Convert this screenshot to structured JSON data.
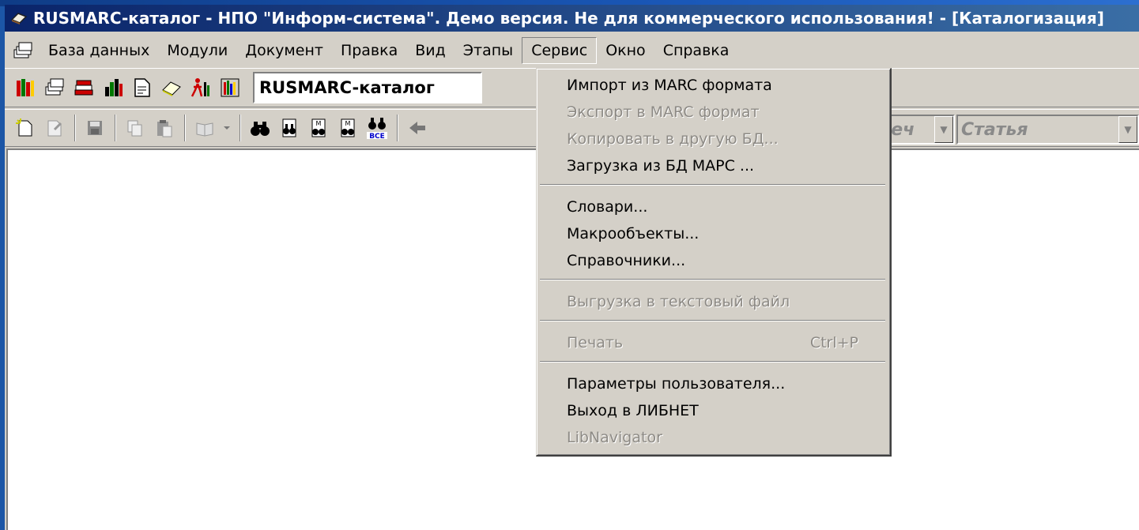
{
  "window": {
    "title": "RUSMARC-каталог - НПО \"Информ-система\". Демо версия. Не для коммерческого использования! - [Каталогизация]"
  },
  "menubar": {
    "items": [
      {
        "label": "База данных"
      },
      {
        "label": "Модули"
      },
      {
        "label": "Документ"
      },
      {
        "label": "Правка"
      },
      {
        "label": "Вид"
      },
      {
        "label": "Этапы"
      },
      {
        "label": "Сервис"
      },
      {
        "label": "Окно"
      },
      {
        "label": "Справка"
      }
    ],
    "active": "Сервис"
  },
  "toolbar1": {
    "database_value": "RUSMARC-каталог"
  },
  "toolbar2": {
    "combo1_value": "неч",
    "combo2_value": "Статья"
  },
  "service_menu": {
    "items": [
      {
        "label": "Импорт из MARC формата",
        "enabled": true
      },
      {
        "label": "Экспорт в MARC формат",
        "enabled": false
      },
      {
        "label": "Копировать в другую БД...",
        "enabled": false
      },
      {
        "label": "Загрузка из БД МАРС ...",
        "enabled": true
      },
      {
        "label": "Словари...",
        "enabled": true
      },
      {
        "label": "Макрообъекты...",
        "enabled": true
      },
      {
        "label": "Справочники...",
        "enabled": true
      },
      {
        "label": "Выгрузка в текстовый файл",
        "enabled": false
      },
      {
        "label": "Печать",
        "shortcut": "Ctrl+P",
        "enabled": false
      },
      {
        "label": "Параметры пользователя...",
        "enabled": true
      },
      {
        "label": "Выход в ЛИБНЕТ",
        "enabled": true
      },
      {
        "label": "LibNavigator",
        "enabled": false
      }
    ]
  }
}
